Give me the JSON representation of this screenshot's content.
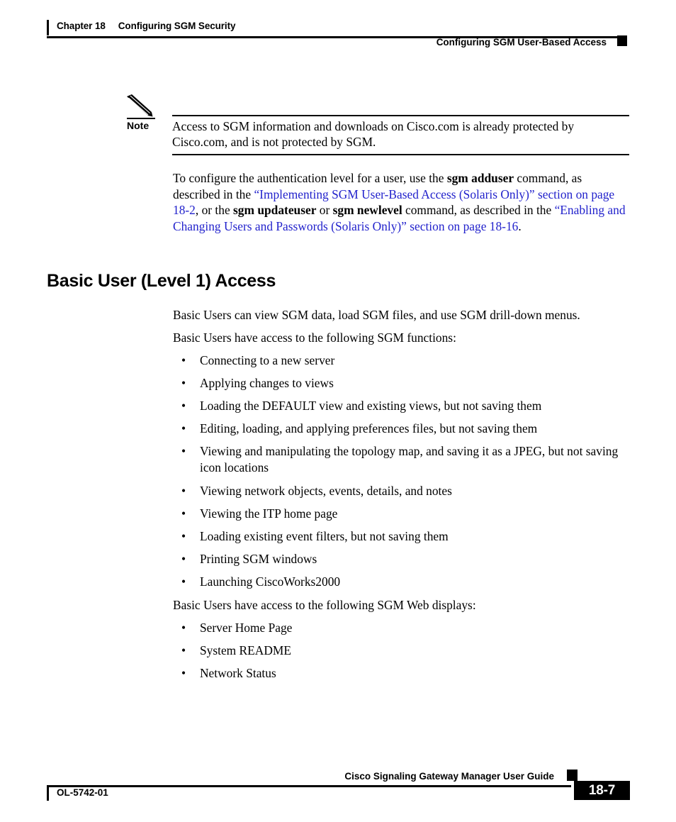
{
  "header": {
    "chapter_number": "Chapter 18",
    "chapter_title": "Configuring SGM Security",
    "running_head": "Configuring SGM User-Based Access"
  },
  "note": {
    "label": "Note",
    "icon": "pencil-icon",
    "text": "Access to SGM information and downloads on Cisco.com is already protected by Cisco.com, and is not protected by SGM."
  },
  "intro_paragraph": {
    "part1": "To configure the authentication level for a user, use the ",
    "cmd1": "sgm adduser",
    "part2": " command, as described in the ",
    "link1": "“Implementing SGM User-Based Access (Solaris Only)” section on page 18-2",
    "part3": ", or the ",
    "cmd2": "sgm updateuser",
    "part4": " or ",
    "cmd3": "sgm newlevel",
    "part5": " command, as described in the ",
    "link2": "“Enabling and Changing Users and Passwords (Solaris Only)” section on page 18-16",
    "part6": "."
  },
  "section": {
    "heading": "Basic User (Level 1) Access",
    "paragraph1": "Basic Users can view SGM data, load SGM files, and use SGM drill-down menus.",
    "paragraph2": "Basic Users have access to the following SGM functions:",
    "functions": [
      "Connecting to a new server",
      "Applying changes to views",
      "Loading the DEFAULT view and existing views, but not saving them",
      "Editing, loading, and applying preferences files, but not saving them",
      "Viewing and manipulating the topology map, and saving it as a JPEG, but not saving icon locations",
      "Viewing network objects, events, details, and notes",
      "Viewing the ITP home page",
      "Loading existing event filters, but not saving them",
      "Printing SGM windows",
      "Launching CiscoWorks2000"
    ],
    "paragraph3": "Basic Users have access to the following SGM Web displays:",
    "web_displays": [
      "Server Home Page",
      "System README",
      "Network Status"
    ],
    "bullet_glyph": "•"
  },
  "footer": {
    "guide_title": "Cisco Signaling Gateway Manager User Guide",
    "document_id": "OL-5742-01",
    "page_number": "18-7"
  },
  "colors": {
    "link": "#2222cc",
    "text": "#000000",
    "background": "#ffffff"
  }
}
